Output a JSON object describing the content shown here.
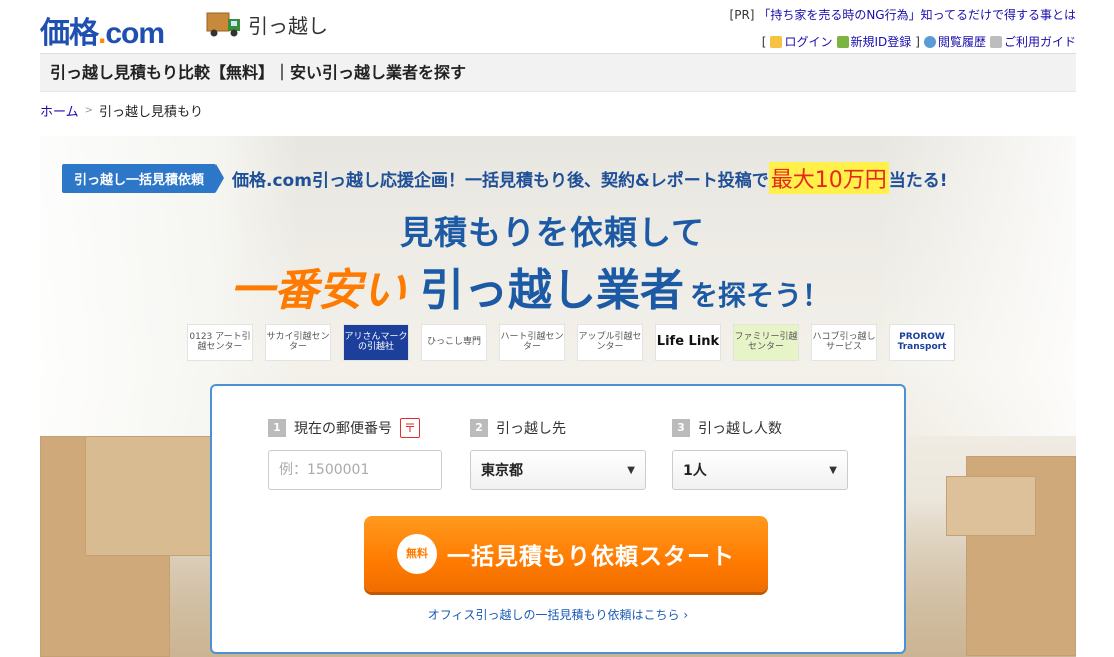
{
  "header": {
    "logo": {
      "main": "価格",
      "dot": ".",
      "com": "com"
    },
    "service_name": "引っ越し",
    "pr_label": "[PR]",
    "pr_text": "「持ち家を売る時のNG行為」知ってるだけで得する事とは",
    "bracket_open": "[",
    "bracket_close": "]",
    "login": "ログイン",
    "register": "新規ID登録",
    "history": "閲覧履歴",
    "guide": "ご利用ガイド"
  },
  "page_title": "引っ越し見積もり比較【無料】｜安い引っ越し業者を探す",
  "breadcrumb": {
    "home": "ホーム",
    "sep": ">",
    "current": "引っ越し見積もり"
  },
  "hero": {
    "tag": "引っ越し一括見積依頼",
    "campaign_text": "価格.com引っ越し応援企画！一括見積もり後、契約&レポート投稿で",
    "campaign_highlight": "最大10万円",
    "campaign_tail": "当たる!",
    "headline1": "見積もりを依頼して",
    "headline2_orange": "一番安い",
    "headline2_blue": "引っ越し業者",
    "headline2_small": "を探そう！",
    "logos": [
      {
        "text": "0123 アート引越センター"
      },
      {
        "text": "サカイ引越センター"
      },
      {
        "text": "アリさんマークの引越社"
      },
      {
        "text": "ひっこし専門"
      },
      {
        "text": "ハート引越センター"
      },
      {
        "text": "アップル引越センター"
      },
      {
        "text": "Life Link"
      },
      {
        "text": "ファミリー引越センター"
      },
      {
        "text": "ハコブ引っ越しサービス"
      },
      {
        "text": "PROROW Transport"
      }
    ]
  },
  "form": {
    "postal": {
      "num": "1",
      "label": "現在の郵便番号",
      "mark": "〒",
      "placeholder": "例：1500001"
    },
    "destination": {
      "num": "2",
      "label": "引っ越し先",
      "value": "東京都"
    },
    "people": {
      "num": "3",
      "label": "引っ越し人数",
      "value": "1人"
    },
    "cta_free": "無料",
    "cta_label": "一括見積もり依頼スタート",
    "office_link": "オフィス引っ越しの一括見積もり依頼はこちら ›"
  },
  "colors": {
    "brand_blue": "#1f4fb0",
    "accent_orange": "#ff7b00",
    "link_blue": "#1a0dab"
  }
}
